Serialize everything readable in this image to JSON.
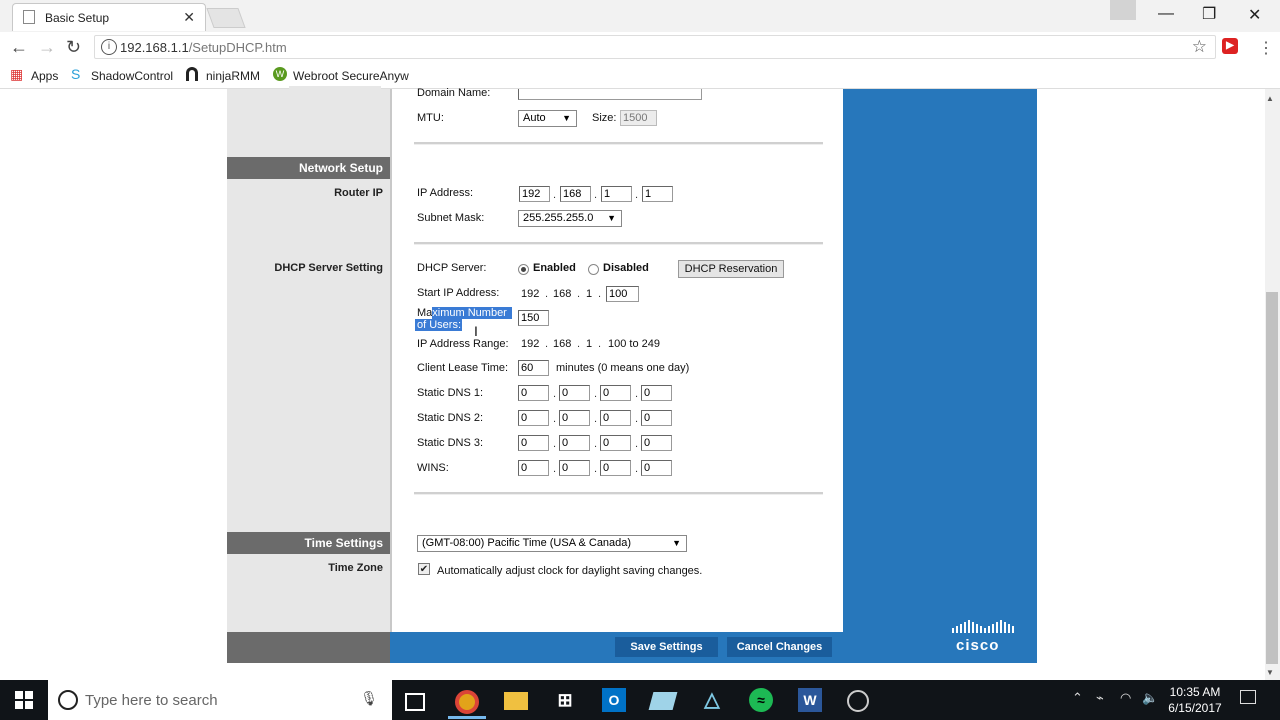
{
  "browser": {
    "tab_title": "Basic Setup",
    "url_host": "192.168.1.1",
    "url_path": "/SetupDHCP.htm",
    "bookmarks": [
      "Apps",
      "ShadowControl",
      "ninjaRMM",
      "Webroot SecureAnyw"
    ]
  },
  "page": {
    "domain_name_label": "Domain Name:",
    "mtu_label": "MTU:",
    "mtu_value": "Auto",
    "size_label": "Size:",
    "size_value": "1500",
    "network_setup_title": "Network Setup",
    "router_ip_label": "Router IP",
    "ip_address_label": "IP Address:",
    "ip_octets": [
      "192",
      "168",
      "1",
      "1"
    ],
    "subnet_mask_label": "Subnet Mask:",
    "subnet_mask_value": "255.255.255.0",
    "dhcp_server_setting_label": "DHCP Server Setting",
    "dhcp_server_label": "DHCP Server:",
    "enabled_label": "Enabled",
    "disabled_label": "Disabled",
    "dhcp_reservation_button": "DHCP Reservation",
    "start_ip_label": "Start IP Address:",
    "start_ip_fixed": [
      "192",
      "168",
      "1"
    ],
    "start_ip_last": "100",
    "max_users_label_line1_plain": "Ma",
    "max_users_label_line1_sel": "ximum Number",
    "max_users_label_line2": "of Users:",
    "max_users_value": "150",
    "ip_range_label": "IP Address Range:",
    "ip_range_fixed": [
      "192",
      "168",
      "1"
    ],
    "ip_range_value": "100 to 249",
    "client_lease_label": "Client Lease Time:",
    "client_lease_value": "60",
    "client_lease_suffix": "minutes (0 means one day)",
    "static_dns1_label": "Static DNS 1:",
    "static_dns2_label": "Static DNS 2:",
    "static_dns3_label": "Static DNS 3:",
    "wins_label": "WINS:",
    "zero": "0",
    "time_settings_title": "Time Settings",
    "time_zone_label": "Time Zone",
    "time_zone_value": "(GMT-08:00) Pacific Time (USA & Canada)",
    "dst_label": "Automatically adjust clock for daylight saving changes.",
    "save_button": "Save Settings",
    "cancel_button": "Cancel Changes",
    "cisco_logo": "cisco"
  },
  "taskbar": {
    "search_placeholder": "Type here to search",
    "time": "10:35 AM",
    "date": "6/15/2017"
  }
}
